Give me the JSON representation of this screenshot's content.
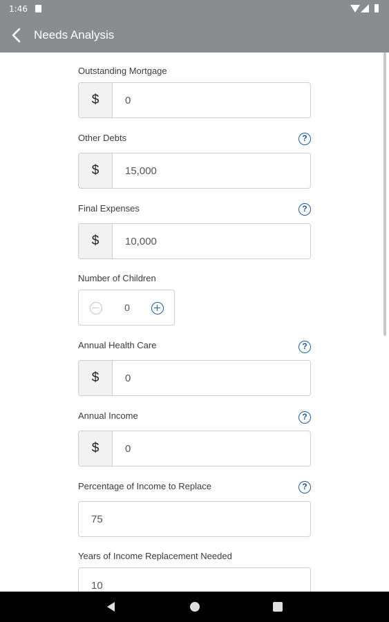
{
  "status_bar": {
    "time": "1:46",
    "icons": [
      "sim-card-icon",
      "wifi-icon",
      "signal-icon",
      "battery-icon"
    ]
  },
  "app_bar": {
    "title": "Needs Analysis",
    "back_icon": "chevron-left-icon"
  },
  "form": {
    "currency_symbol": "$",
    "help_glyph": "?",
    "outstanding_mortgage": {
      "label": "Outstanding Mortgage",
      "value": "0"
    },
    "other_debts": {
      "label": "Other Debts",
      "value": "15,000"
    },
    "final_expenses": {
      "label": "Final Expenses",
      "value": "10,000"
    },
    "number_of_children": {
      "label": "Number of Children",
      "value": "0"
    },
    "annual_health_care": {
      "label": "Annual Health Care",
      "value": "0"
    },
    "annual_income": {
      "label": "Annual Income",
      "value": "0"
    },
    "percentage_income_replace": {
      "label": "Percentage of Income to Replace",
      "value": "75"
    },
    "years_income_replacement": {
      "label": "Years of Income Replacement Needed",
      "value": "10"
    }
  },
  "colors": {
    "app_bar": "#8a8d8f",
    "accent": "#1f5c99",
    "field_border": "#cfcfcf",
    "prefix_bg": "#f2f2f2"
  }
}
